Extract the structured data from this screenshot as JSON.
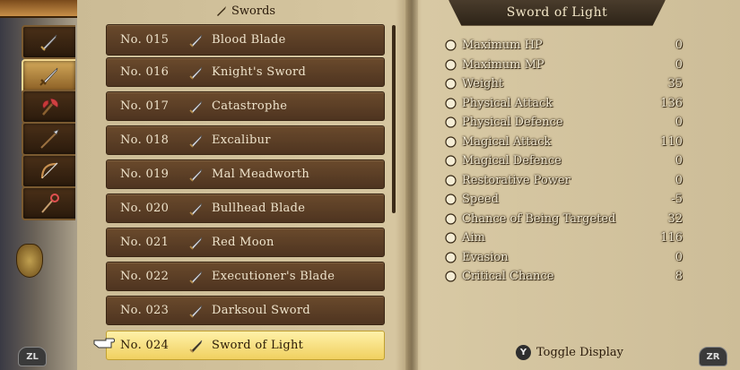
{
  "category": {
    "label": "Swords"
  },
  "tabs": [
    {
      "icon": "bare-sword-icon"
    },
    {
      "icon": "sword-icon",
      "active": true
    },
    {
      "icon": "axe-icon"
    },
    {
      "icon": "spear-icon"
    },
    {
      "icon": "bow-icon"
    },
    {
      "icon": "staff-icon"
    }
  ],
  "buttons": {
    "zl": "ZL",
    "zr": "ZR",
    "y": "Y"
  },
  "items": [
    {
      "num": "No. 015",
      "name": "Blood Blade"
    },
    {
      "num": "No. 016",
      "name": "Knight's Sword"
    },
    {
      "num": "No. 017",
      "name": "Catastrophe"
    },
    {
      "num": "No. 018",
      "name": "Excalibur"
    },
    {
      "num": "No. 019",
      "name": "Mal Meadworth"
    },
    {
      "num": "No. 020",
      "name": "Bullhead Blade"
    },
    {
      "num": "No. 021",
      "name": "Red Moon"
    },
    {
      "num": "No. 022",
      "name": "Executioner's Blade"
    },
    {
      "num": "No. 023",
      "name": "Darksoul Sword"
    },
    {
      "num": "No. 024",
      "name": "Sword of Light",
      "selected": true
    }
  ],
  "detail": {
    "title": "Sword of Light",
    "stats": [
      {
        "label": "Maximum HP",
        "value": "0",
        "icon": "heart-icon"
      },
      {
        "label": "Maximum MP",
        "value": "0",
        "icon": "sparkle-icon"
      },
      {
        "label": "Weight",
        "value": "35",
        "icon": "weight-icon"
      },
      {
        "label": "Physical Attack",
        "value": "136",
        "icon": "physical-attack-icon"
      },
      {
        "label": "Physical Defence",
        "value": "0",
        "icon": "shield-icon"
      },
      {
        "label": "Magical Attack",
        "value": "110",
        "icon": "wand-icon"
      },
      {
        "label": "Magical Defence",
        "value": "0",
        "icon": "magic-shield-icon"
      },
      {
        "label": "Restorative Power",
        "value": "0",
        "icon": "restore-icon"
      },
      {
        "label": "Speed",
        "value": "-5",
        "icon": "speed-icon"
      },
      {
        "label": "Chance of Being Targeted",
        "value": "32",
        "icon": "eye-icon"
      },
      {
        "label": "Aim",
        "value": "116",
        "icon": "aim-icon"
      },
      {
        "label": "Evasion",
        "value": "0",
        "icon": "feather-icon"
      },
      {
        "label": "Critical Chance",
        "value": "8",
        "icon": "critical-icon"
      }
    ]
  },
  "toggle": {
    "label": "Toggle Display"
  }
}
